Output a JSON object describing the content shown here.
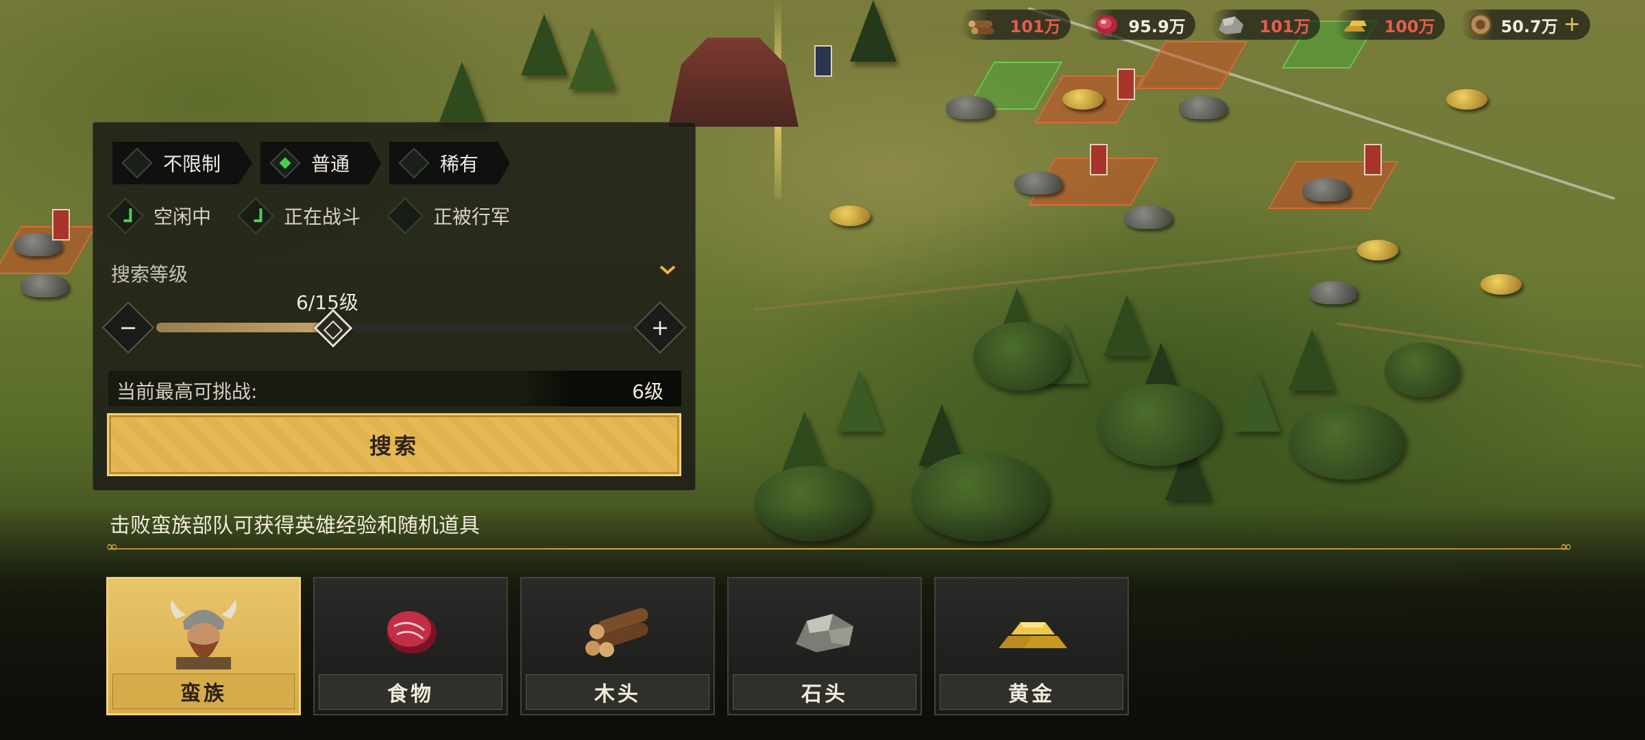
{
  "resources": [
    {
      "name": "wood",
      "icon": "wood-icon",
      "value": "101万",
      "warn": true
    },
    {
      "name": "food",
      "icon": "meat-icon",
      "value": "95.9万",
      "warn": false
    },
    {
      "name": "stone",
      "icon": "stone-icon",
      "value": "101万",
      "warn": true
    },
    {
      "name": "gold",
      "icon": "gold-bars-icon",
      "value": "100万",
      "warn": true
    },
    {
      "name": "coin",
      "icon": "coin-icon",
      "value": "50.7万",
      "warn": false,
      "plus": "+"
    }
  ],
  "panel": {
    "quality_filters": [
      {
        "label": "不限制",
        "selected": false
      },
      {
        "label": "普通",
        "selected": true
      },
      {
        "label": "稀有",
        "selected": false
      }
    ],
    "status_filters": [
      {
        "label": "空闲中",
        "checked": true
      },
      {
        "label": "正在战斗",
        "checked": true
      },
      {
        "label": "正被行军",
        "checked": false
      }
    ],
    "level_label": "搜索等级",
    "level_value": "6/15级",
    "level_current": 6,
    "level_max": 15,
    "minus": "−",
    "plus": "+",
    "max_challenge_label": "当前最高可挑战:",
    "max_challenge_value": "6级",
    "search_button": "搜索"
  },
  "tip": "击败蛮族部队可获得英雄经验和随机道具",
  "categories": [
    {
      "label": "蛮族",
      "icon": "barbarian-icon",
      "selected": true
    },
    {
      "label": "食物",
      "icon": "meat-icon",
      "selected": false
    },
    {
      "label": "木头",
      "icon": "logs-icon",
      "selected": false
    },
    {
      "label": "石头",
      "icon": "stone-icon",
      "selected": false
    },
    {
      "label": "黄金",
      "icon": "gold-bars-icon",
      "selected": false
    }
  ],
  "colors": {
    "accent_gold": "#e6b955",
    "warn_red": "#e85d4e",
    "check_green": "#44d24a"
  }
}
